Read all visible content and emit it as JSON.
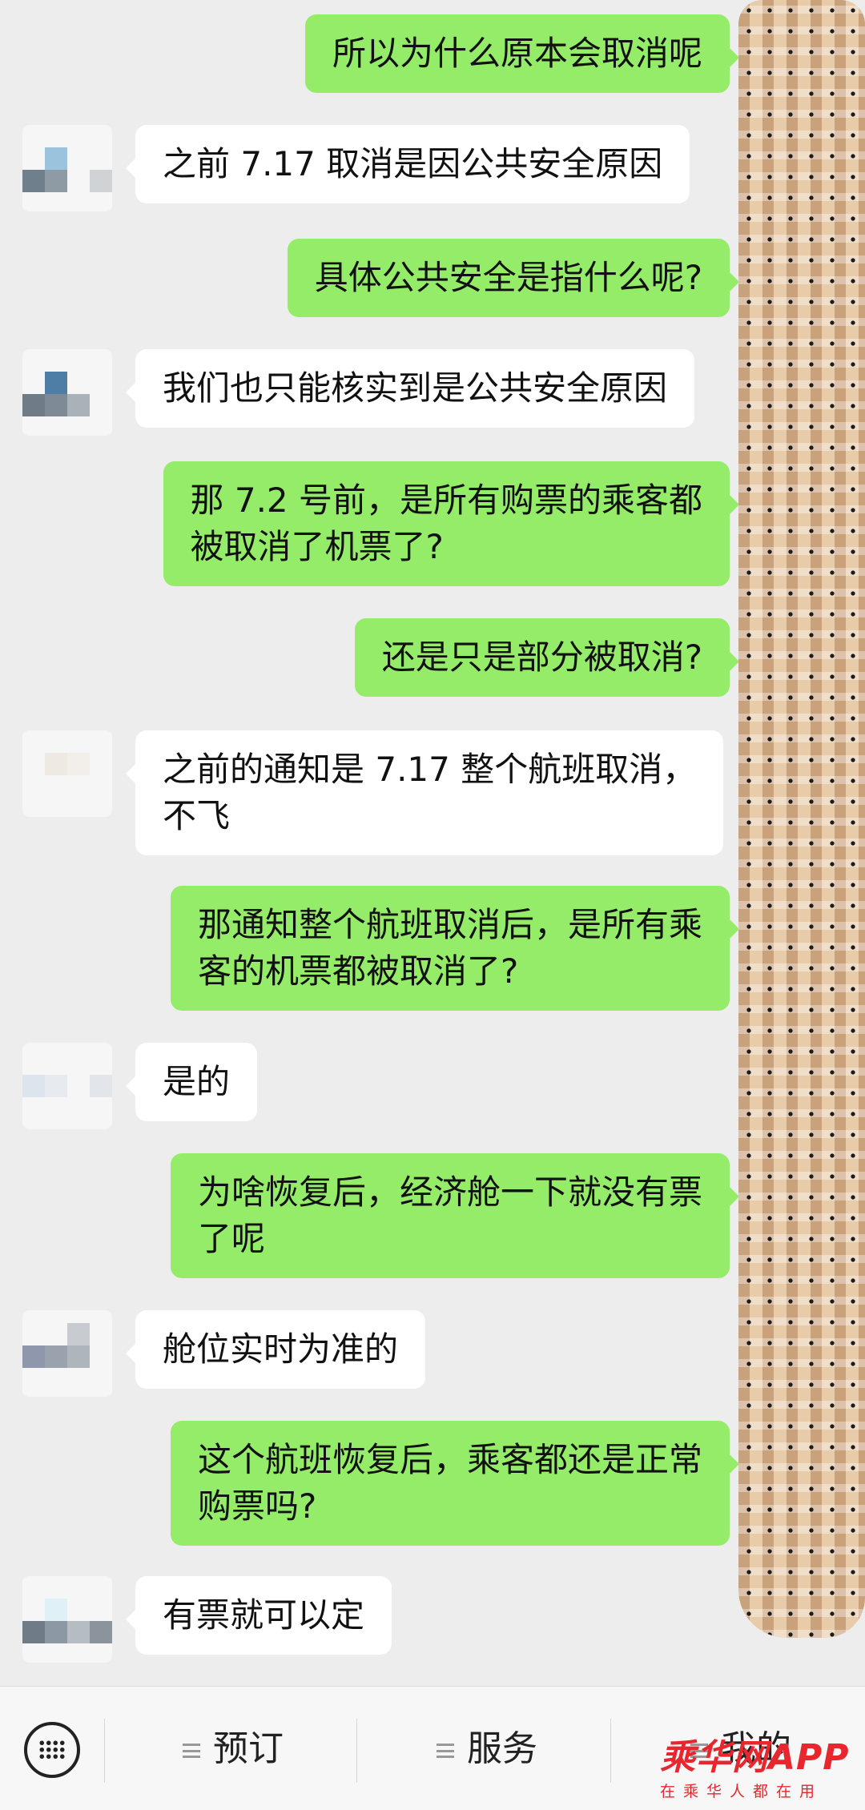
{
  "messages": [
    {
      "side": "out",
      "text": "所以为什么原本会取消呢"
    },
    {
      "side": "in",
      "text": "之前 7.17 取消是因公共安全原因"
    },
    {
      "side": "out",
      "text": "具体公共安全是指什么呢?"
    },
    {
      "side": "in",
      "text": "我们也只能核实到是公共安全原因"
    },
    {
      "side": "out",
      "text": "那 7.2 号前，是所有购票的乘客都\n被取消了机票了?"
    },
    {
      "side": "out",
      "text": "还是只是部分被取消?"
    },
    {
      "side": "in",
      "text": "之前的通知是 7.17 整个航班取消，\n不飞"
    },
    {
      "side": "out",
      "text": "那通知整个航班取消后，是所有乘\n客的机票都被取消了?"
    },
    {
      "side": "in",
      "text": "是的"
    },
    {
      "side": "out",
      "text": "为啥恢复后，经济舱一下就没有票\n了呢"
    },
    {
      "side": "in",
      "text": "舱位实时为准的"
    },
    {
      "side": "out",
      "text": "这个航班恢复后，乘客都还是正常\n购票吗?"
    },
    {
      "side": "in",
      "text": "有票就可以定"
    }
  ],
  "menu": {
    "item1": "预订",
    "item2": "服务",
    "item3": "我的"
  },
  "watermark": {
    "main": "乘华网APP",
    "sub": "在乘华人都在用"
  },
  "colors": {
    "outgoing_bubble": "#95ec69",
    "incoming_bubble": "#ffffff",
    "background": "#ededed",
    "watermark": "#e8262d"
  },
  "icons": [
    "keyboard-icon",
    "menu-icon"
  ]
}
